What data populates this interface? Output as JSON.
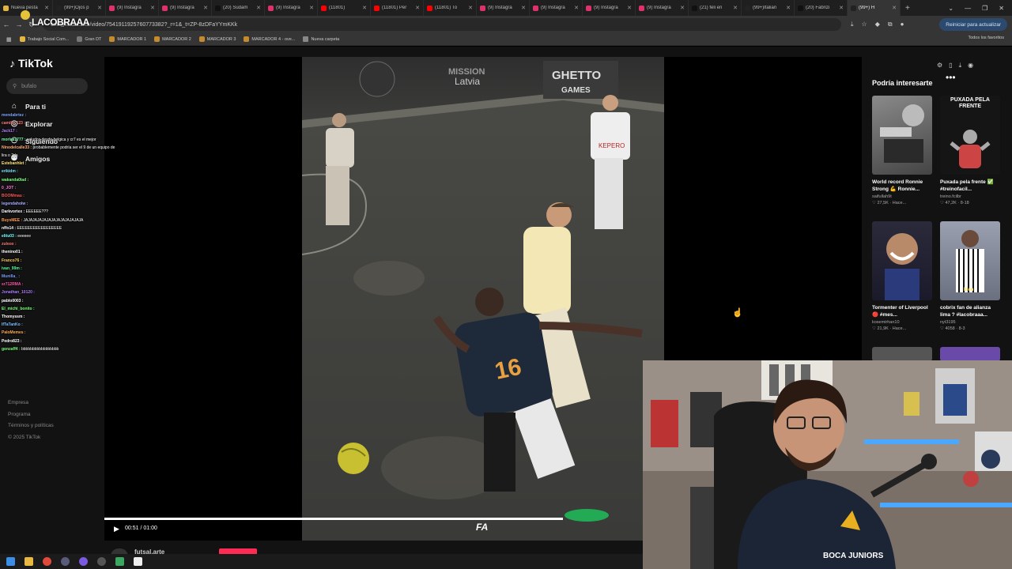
{
  "browser": {
    "tabs": [
      {
        "title": "Nueva pesta",
        "color": "#e2b640",
        "active": false
      },
      {
        "title": "(99+)Ojos p",
        "color": "#222222",
        "active": false
      },
      {
        "title": "(9) Instagra",
        "color": "#e1306c",
        "active": false
      },
      {
        "title": "(9) Instagra",
        "color": "#e1306c",
        "active": false
      },
      {
        "title": "(20) Sudam",
        "color": "#111111",
        "active": false
      },
      {
        "title": "(9) Instagra",
        "color": "#e1306c",
        "active": false
      },
      {
        "title": "(11801)",
        "color": "#ff0000",
        "active": false
      },
      {
        "title": "(11801) Per",
        "color": "#ff0000",
        "active": false
      },
      {
        "title": "(11801) To",
        "color": "#ff0000",
        "active": false
      },
      {
        "title": "(9) Instagra",
        "color": "#e1306c",
        "active": false
      },
      {
        "title": "(9) Instagra",
        "color": "#e1306c",
        "active": false
      },
      {
        "title": "(9) Instagra",
        "color": "#e1306c",
        "active": false
      },
      {
        "title": "(9) Instagra",
        "color": "#e1306c",
        "active": false
      },
      {
        "title": "(21) feli en",
        "color": "#111111",
        "active": false
      },
      {
        "title": "(99+)Italian",
        "color": "#222222",
        "active": false
      },
      {
        "title": "(20) Fabrizi",
        "color": "#111111",
        "active": false
      },
      {
        "title": "(99+) H",
        "color": "#222222",
        "active": true
      }
    ],
    "new_tab": "+",
    "window_controls": [
      "⌄",
      "—",
      "❐",
      "✕"
    ],
    "url": "om/@futsal.arte/video/7541911925760773382?_r=1&_t=ZP-8zDFaYYmKKk",
    "overlay_logo": "LACOBRAAA",
    "restart_button": "Reiniciar para actualizar",
    "bookmarks": [
      "Trabajo Social Com...",
      "Gran DT",
      "MARCADOR 1",
      "MARCADOR 2",
      "MARCADOR 3",
      "MARCADOR 4 - ove...",
      "Nueva carpeta"
    ],
    "bookmarks_all": "Todos los favoritos"
  },
  "tiktok": {
    "logo": "TikTok",
    "search_placeholder": "bufalo",
    "nav": [
      {
        "label": "Para ti",
        "icon": "home-icon",
        "glyph": "⌂"
      },
      {
        "label": "Explorar",
        "icon": "compass-icon",
        "glyph": "◎"
      },
      {
        "label": "Siguiendo",
        "icon": "following-icon",
        "glyph": "⚇"
      },
      {
        "label": "Amigos",
        "icon": "friends-icon",
        "glyph": "⚉"
      }
    ],
    "footer": [
      "Empresa",
      "Programa",
      "Términos y políticas",
      "© 2025 TikTok"
    ]
  },
  "chat": [
    {
      "user": "mendabrtez :",
      "msg": "",
      "color": "#7aa7ff"
    },
    {
      "user": "camilo_123 :",
      "msg": "",
      "color": "#ff7a7a"
    },
    {
      "user": "Jack17 :",
      "msg": "",
      "color": "#b07aff"
    },
    {
      "user": "morlas1777 :",
      "msg": "saludos desde belgica y cr7 es el mejor",
      "color": "#7affb0"
    },
    {
      "user": "Ninodelcalle33 :",
      "msg": "probablemente podría ser el 9 de un equipo de",
      "color": "#ffb07a"
    },
    {
      "user": "",
      "msg": "lira o 2da",
      "color": "#ffffff"
    },
    {
      "user": "Estebanhlet :",
      "msg": "",
      "color": "#ffe07a"
    },
    {
      "user": "erikidm :",
      "msg": "",
      "color": "#7ae0ff"
    },
    {
      "user": "wakanda0lad :",
      "msg": "",
      "color": "#7aff7a"
    },
    {
      "user": "0_JOT :",
      "msg": "",
      "color": "#ff7ae0"
    },
    {
      "user": "BOOMmau :",
      "msg": "",
      "color": "#ff5555"
    },
    {
      "user": "legendaholw :",
      "msg": "",
      "color": "#aaaaff"
    },
    {
      "user": "Darkvortex :",
      "msg": "EEEEEE???",
      "color": "#ffffff"
    },
    {
      "user": "BuysMEE :",
      "msg": "JAJAJAJAJAJAJAJAJAJAJAJAJA",
      "color": "#ff9a55"
    },
    {
      "user": "nffo14 :",
      "msg": "EEEEEEEEEEEEEEEEE",
      "color": "#ffffff"
    },
    {
      "user": "elitu03 :",
      "msg": "eeeeee",
      "color": "#7affff"
    },
    {
      "user": "zuleox :",
      "msg": "",
      "color": "#ff7a7a"
    },
    {
      "user": "thenino01 :",
      "msg": "",
      "color": "#ffffff"
    },
    {
      "user": "Franco76 :",
      "msg": "",
      "color": "#ffcc55"
    },
    {
      "user": "ivan_99m :",
      "msg": "",
      "color": "#55ff99"
    },
    {
      "user": "Munilla_ :",
      "msg": "",
      "color": "#7a9aff"
    },
    {
      "user": "sr712RMA :",
      "msg": "",
      "color": "#ff55aa"
    },
    {
      "user": "Jonathan_10120 :",
      "msg": "",
      "color": "#aa7aff"
    },
    {
      "user": "pablo0003 :",
      "msg": "",
      "color": "#ffffff"
    },
    {
      "user": "El_michi_bonito :",
      "msg": "",
      "color": "#7aff7a"
    },
    {
      "user": "Thomyssm :",
      "msg": "",
      "color": "#ffffff"
    },
    {
      "user": "IfTaTanKo :",
      "msg": "",
      "color": "#7ac0ff"
    },
    {
      "user": "PaloMemes :",
      "msg": "",
      "color": "#ffaa55"
    },
    {
      "user": "Pedro823 :",
      "msg": "",
      "color": "#ffffff"
    },
    {
      "user": "gonzaff4 :",
      "msg": "bbbbbbbbbbbbbbbbb",
      "color": "#7aff7a"
    }
  ],
  "video": {
    "time": "00:51 / 01:00",
    "progress": 0.85,
    "watermark": "FA",
    "author": "futsal.arte",
    "more": "•••",
    "sign_mission": "MISSION",
    "sign_latvia": "Latvia",
    "sign_ghetto": "GHETTO",
    "sign_games": "GAMES",
    "jersey_number": "16"
  },
  "right_panel": {
    "title": "Podría interesarte",
    "cards": [
      {
        "title": "World record Ronnie Strong 💪 Ronnie...",
        "author": "saifullah9t",
        "stats": "♡ 27,5K · Hace...",
        "overlay": "",
        "bg": "#6b6b6b"
      },
      {
        "title": "Puxada pela frente ✅ #treinofacil...",
        "author": "treino.fcilbr",
        "stats": "♡ 47,2K · 8-18",
        "overlay": "PUXADA PELA FRENTE",
        "bg": "#1a1a1a"
      },
      {
        "title": "Tormenter of Liverpool 🔴 #mes...",
        "author": "kosemirhan10",
        "stats": "♡ 21,9K · Hace...",
        "overlay": "",
        "bg": "#2a2a40"
      },
      {
        "title": "cobrix fan de alianza lima ? #lacobraaa...",
        "author": "nyt3195",
        "stats": "♡ 4058 · 8-3",
        "overlay": "bien",
        "bg": "#8a8fa0"
      }
    ]
  }
}
